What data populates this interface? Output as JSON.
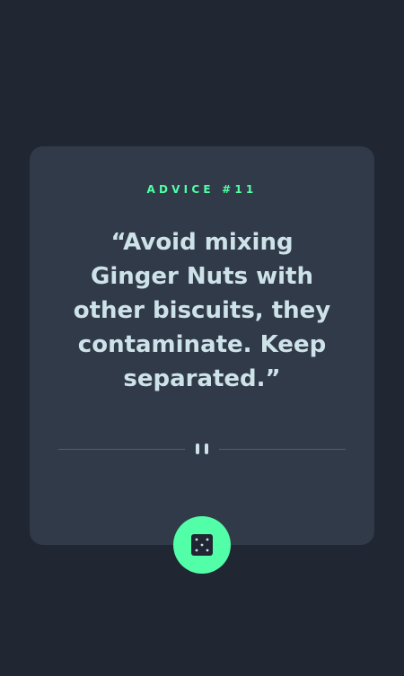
{
  "card": {
    "advice_label": "ADVICE #11",
    "advice_text": "“Avoid mixing Ginger Nuts with other biscuits, they contaminate. Keep separated.”"
  },
  "icons": {
    "divider": "pause-icon",
    "dice": "dice-icon"
  },
  "colors": {
    "background": "#202733",
    "card": "#313a48",
    "accent": "#52ffa8",
    "text": "#cee3e9",
    "divider": "#4f5d74"
  }
}
